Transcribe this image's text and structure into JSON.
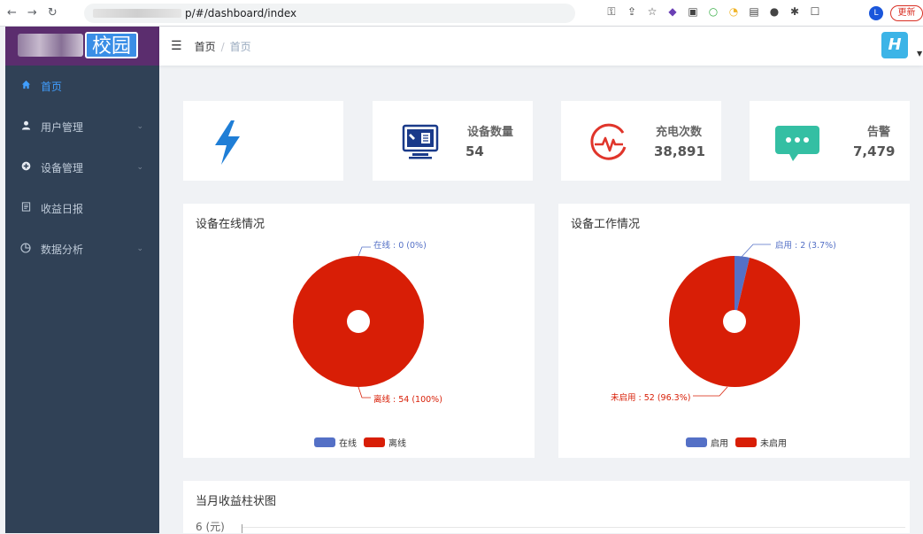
{
  "browser": {
    "url": "p/#/dashboard/index",
    "update_label": "更新",
    "profile_letter": "L"
  },
  "sidebar": {
    "logo_text": "校园",
    "items": [
      {
        "label": "首页",
        "icon": "home-icon",
        "active": true
      },
      {
        "label": "用户管理",
        "icon": "user-icon",
        "has_children": true
      },
      {
        "label": "设备管理",
        "icon": "device-icon",
        "has_children": true
      },
      {
        "label": "收益日报",
        "icon": "report-icon"
      },
      {
        "label": "数据分析",
        "icon": "chart-icon",
        "has_children": true
      }
    ]
  },
  "header": {
    "breadcrumb_home": "首页",
    "breadcrumb_current": "首页",
    "avatar_letter": "H"
  },
  "stats": [
    {
      "label": "",
      "value": "",
      "icon": "lightning-icon",
      "color": "#1f7ed6"
    },
    {
      "label": "设备数量",
      "value": "54",
      "icon": "device-monitor-icon",
      "color": "#1a3a8a"
    },
    {
      "label": "充电次数",
      "value": "38,891",
      "icon": "heartbeat-icon",
      "color": "#e0352b"
    },
    {
      "label": "告警",
      "value": "7,479",
      "icon": "message-icon",
      "color": "#34bfa3"
    }
  ],
  "charts": {
    "online": {
      "title": "设备在线情况",
      "label_a": "在线 : 0 (0%)",
      "label_b": "离线 : 54 (100%)",
      "legend_a": "在线",
      "legend_b": "离线"
    },
    "work": {
      "title": "设备工作情况",
      "label_a": "启用 : 2 (3.7%)",
      "label_b": "未启用 : 52 (96.3%)",
      "legend_a": "启用",
      "legend_b": "未启用"
    },
    "income": {
      "title": "当月收益柱状图",
      "y_label": "6 (元)"
    }
  },
  "chart_data": [
    {
      "type": "pie",
      "title": "设备在线情况",
      "labels": [
        "在线",
        "离线"
      ],
      "values": [
        0,
        54
      ],
      "colors": [
        "#5470c6",
        "#d81e06"
      ],
      "legend": "bottom"
    },
    {
      "type": "pie",
      "title": "设备工作情况",
      "labels": [
        "启用",
        "未启用"
      ],
      "values": [
        2,
        52
      ],
      "colors": [
        "#5470c6",
        "#d81e06"
      ],
      "legend": "bottom"
    }
  ]
}
